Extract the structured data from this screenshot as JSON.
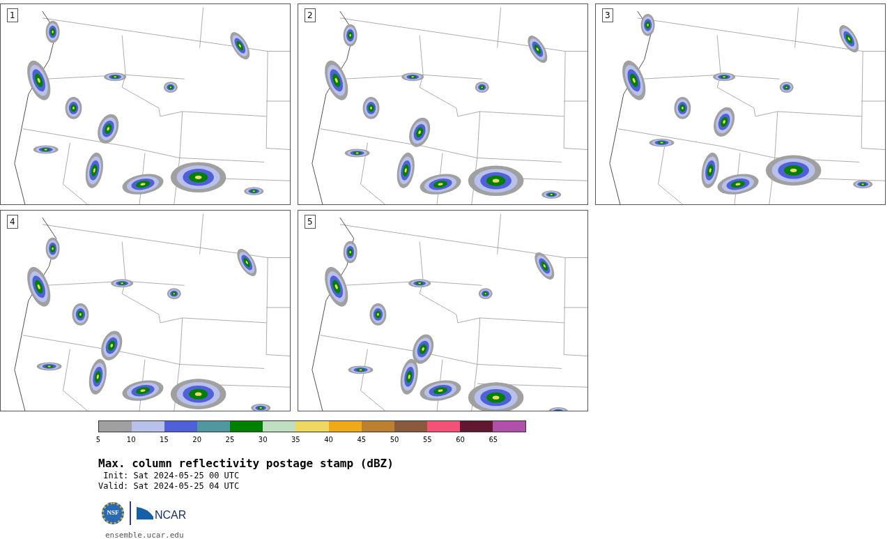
{
  "panels": [
    {
      "label": "1"
    },
    {
      "label": "2"
    },
    {
      "label": "3"
    },
    {
      "label": "4"
    },
    {
      "label": "5"
    }
  ],
  "legend": {
    "bins": [
      {
        "color": "#a0a0a0"
      },
      {
        "color": "#b8c0ec"
      },
      {
        "color": "#5060d8"
      },
      {
        "color": "#50979f"
      },
      {
        "color": "#008000"
      },
      {
        "color": "#c0dfc0"
      },
      {
        "color": "#f0d860"
      },
      {
        "color": "#f0aa18"
      },
      {
        "color": "#bc8030"
      },
      {
        "color": "#8a5a3c"
      },
      {
        "color": "#f45078"
      },
      {
        "color": "#601830"
      },
      {
        "color": "#b050a8"
      }
    ],
    "ticks": [
      "5",
      "10",
      "15",
      "20",
      "25",
      "30",
      "35",
      "40",
      "45",
      "50",
      "55",
      "60",
      "65"
    ]
  },
  "title": "Max. column reflectivity postage stamp (dBZ)",
  "init": " Init: Sat 2024-05-25 00 UTC",
  "valid": "Valid: Sat 2024-05-25 04 UTC",
  "logo": {
    "nsf": "NSF",
    "ncar": "NCAR"
  },
  "url": "ensemble.ucar.edu"
}
